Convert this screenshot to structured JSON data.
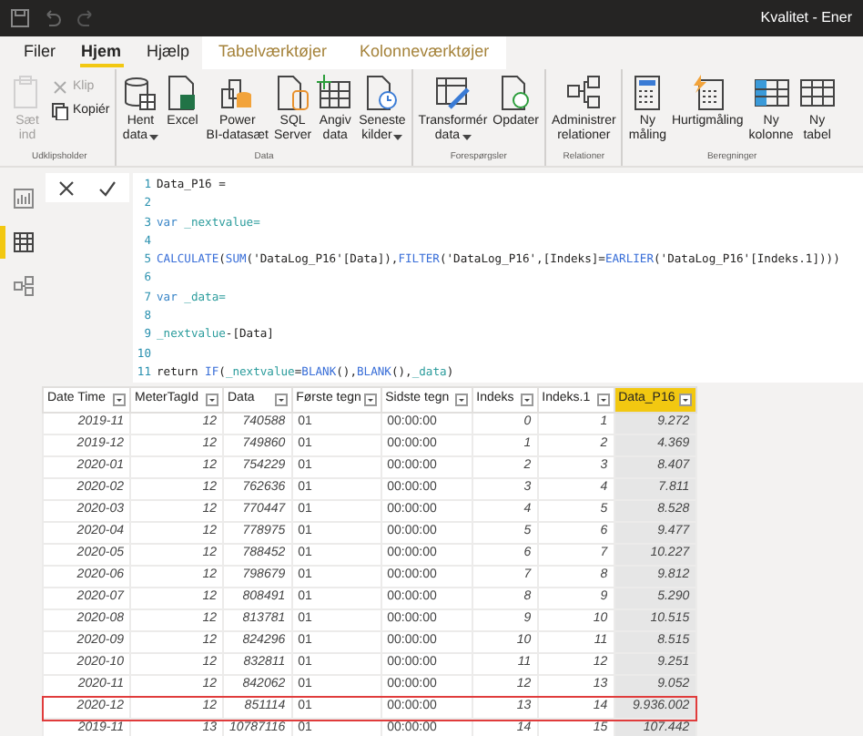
{
  "title_bar": {
    "title": "Kvalitet - Ener"
  },
  "ribbon_tabs": [
    {
      "label": "Filer",
      "selected": false,
      "kind": "plain"
    },
    {
      "label": "Hjem",
      "selected": true,
      "kind": "plain"
    },
    {
      "label": "Hjælp",
      "selected": false,
      "kind": "plain"
    },
    {
      "label": "Tabelværktøjer",
      "selected": false,
      "kind": "contextual"
    },
    {
      "label": "Kolonneværktøjer",
      "selected": false,
      "kind": "contextual"
    }
  ],
  "ribbon_groups": [
    {
      "label": "Udklipsholder",
      "buttons": [
        {
          "label": [
            "Sæt",
            "ind"
          ],
          "kind": "large",
          "disabled": true
        },
        {
          "label": [
            "Klip"
          ],
          "kind": "small",
          "disabled": true
        },
        {
          "label": [
            "Kopiér"
          ],
          "kind": "small",
          "disabled": false
        }
      ]
    },
    {
      "label": "Data",
      "buttons": [
        {
          "label": [
            "Hent",
            "data"
          ],
          "kind": "large",
          "disabled": false,
          "dropdown": true
        },
        {
          "label": [
            "Excel"
          ],
          "kind": "large",
          "disabled": false
        },
        {
          "label": [
            "Power",
            "BI-datasæt"
          ],
          "kind": "large",
          "disabled": false
        },
        {
          "label": [
            "SQL",
            "Server"
          ],
          "kind": "large",
          "disabled": false
        },
        {
          "label": [
            "Angiv",
            "data"
          ],
          "kind": "large",
          "disabled": false
        },
        {
          "label": [
            "Seneste",
            "kilder"
          ],
          "kind": "large",
          "disabled": false,
          "dropdown": true
        }
      ]
    },
    {
      "label": "Forespørgsler",
      "buttons": [
        {
          "label": [
            "Transformér",
            "data"
          ],
          "kind": "large",
          "disabled": false,
          "dropdown": true
        },
        {
          "label": [
            "Opdater"
          ],
          "kind": "large",
          "disabled": false
        }
      ]
    },
    {
      "label": "Relationer",
      "buttons": [
        {
          "label": [
            "Administrer",
            "relationer"
          ],
          "kind": "large",
          "disabled": false
        }
      ]
    },
    {
      "label": "Beregninger",
      "buttons": [
        {
          "label": [
            "Ny",
            "måling"
          ],
          "kind": "large",
          "disabled": false
        },
        {
          "label": [
            "Hurtigmåling"
          ],
          "kind": "large",
          "disabled": false
        },
        {
          "label": [
            "Ny",
            "kolonne"
          ],
          "kind": "large",
          "disabled": false
        },
        {
          "label": [
            "Ny",
            "tabel"
          ],
          "kind": "large",
          "disabled": false
        }
      ]
    }
  ],
  "view_rail": [
    {
      "kind": "report",
      "selected": false
    },
    {
      "kind": "data",
      "selected": true
    },
    {
      "kind": "model",
      "selected": false
    }
  ],
  "formula_bar": {
    "lines": [
      {
        "number": "1",
        "segments": [
          {
            "text": "Data_P16 =",
            "kind": "plain"
          }
        ]
      },
      {
        "number": "2"
      },
      {
        "number": "3",
        "segments": [
          {
            "text": "var",
            "kind": "keyword"
          },
          {
            "text": " _nextvalue=",
            "kind": "variable"
          }
        ]
      },
      {
        "number": "4"
      },
      {
        "number": "5",
        "segments": [
          {
            "text": "CALCULATE",
            "kind": "function"
          },
          {
            "text": "(",
            "kind": "plain"
          },
          {
            "text": "SUM",
            "kind": "function"
          },
          {
            "text": "('DataLog_P16'[Data]),",
            "kind": "plain"
          },
          {
            "text": "FILTER",
            "kind": "function"
          },
          {
            "text": "('DataLog_P16',[Indeks]=",
            "kind": "plain"
          },
          {
            "text": "EARLIER",
            "kind": "function"
          },
          {
            "text": "('DataLog_P16'[Indeks.1])))",
            "kind": "plain"
          }
        ]
      },
      {
        "number": "6"
      },
      {
        "number": "7",
        "segments": [
          {
            "text": "var",
            "kind": "keyword"
          },
          {
            "text": " _data=",
            "kind": "variable"
          }
        ]
      },
      {
        "number": "8"
      },
      {
        "number": "9",
        "segments": [
          {
            "text": "_nextvalue",
            "kind": "variable"
          },
          {
            "text": "-[Data]",
            "kind": "plain"
          }
        ]
      },
      {
        "number": "10"
      },
      {
        "number": "11",
        "segments": [
          {
            "text": "return ",
            "kind": "plain"
          },
          {
            "text": "IF",
            "kind": "function"
          },
          {
            "text": "(",
            "kind": "plain"
          },
          {
            "text": "_nextvalue",
            "kind": "variable"
          },
          {
            "text": "=",
            "kind": "plain"
          },
          {
            "text": "BLANK",
            "kind": "function"
          },
          {
            "text": "(),",
            "kind": "plain"
          },
          {
            "text": "BLANK",
            "kind": "function"
          },
          {
            "text": "(),",
            "kind": "plain"
          },
          {
            "text": "_data",
            "kind": "variable"
          },
          {
            "text": ")",
            "kind": "plain"
          }
        ]
      }
    ]
  },
  "table": {
    "columns": [
      {
        "label": "Date Time",
        "selected": false
      },
      {
        "label": "MeterTagId",
        "selected": false
      },
      {
        "label": "Data",
        "selected": false
      },
      {
        "label": "Første tegn",
        "selected": false
      },
      {
        "label": "Sidste tegn",
        "selected": false
      },
      {
        "label": "Indeks",
        "selected": false
      },
      {
        "label": "Indeks.1",
        "selected": false
      },
      {
        "label": "Data_P16",
        "selected": true
      }
    ],
    "rows": [
      {
        "cells": [
          "2019-11",
          "12",
          "740588",
          "01",
          "00:00:00",
          "0",
          "1",
          "9.272"
        ],
        "highlighted": false
      },
      {
        "cells": [
          "2019-12",
          "12",
          "749860",
          "01",
          "00:00:00",
          "1",
          "2",
          "4.369"
        ],
        "highlighted": false
      },
      {
        "cells": [
          "2020-01",
          "12",
          "754229",
          "01",
          "00:00:00",
          "2",
          "3",
          "8.407"
        ],
        "highlighted": false
      },
      {
        "cells": [
          "2020-02",
          "12",
          "762636",
          "01",
          "00:00:00",
          "3",
          "4",
          "7.811"
        ],
        "highlighted": false
      },
      {
        "cells": [
          "2020-03",
          "12",
          "770447",
          "01",
          "00:00:00",
          "4",
          "5",
          "8.528"
        ],
        "highlighted": false
      },
      {
        "cells": [
          "2020-04",
          "12",
          "778975",
          "01",
          "00:00:00",
          "5",
          "6",
          "9.477"
        ],
        "highlighted": false
      },
      {
        "cells": [
          "2020-05",
          "12",
          "788452",
          "01",
          "00:00:00",
          "6",
          "7",
          "10.227"
        ],
        "highlighted": false
      },
      {
        "cells": [
          "2020-06",
          "12",
          "798679",
          "01",
          "00:00:00",
          "7",
          "8",
          "9.812"
        ],
        "highlighted": false
      },
      {
        "cells": [
          "2020-07",
          "12",
          "808491",
          "01",
          "00:00:00",
          "8",
          "9",
          "5.290"
        ],
        "highlighted": false
      },
      {
        "cells": [
          "2020-08",
          "12",
          "813781",
          "01",
          "00:00:00",
          "9",
          "10",
          "10.515"
        ],
        "highlighted": false
      },
      {
        "cells": [
          "2020-09",
          "12",
          "824296",
          "01",
          "00:00:00",
          "10",
          "11",
          "8.515"
        ],
        "highlighted": false
      },
      {
        "cells": [
          "2020-10",
          "12",
          "832811",
          "01",
          "00:00:00",
          "11",
          "12",
          "9.251"
        ],
        "highlighted": false
      },
      {
        "cells": [
          "2020-11",
          "12",
          "842062",
          "01",
          "00:00:00",
          "12",
          "13",
          "9.052"
        ],
        "highlighted": false
      },
      {
        "cells": [
          "2020-12",
          "12",
          "851114",
          "01",
          "00:00:00",
          "13",
          "14",
          "9.936.002"
        ],
        "highlighted": true
      },
      {
        "cells": [
          "2019-11",
          "13",
          "10787116",
          "01",
          "00:00:00",
          "14",
          "15",
          "107.442"
        ],
        "highlighted": false
      }
    ]
  }
}
